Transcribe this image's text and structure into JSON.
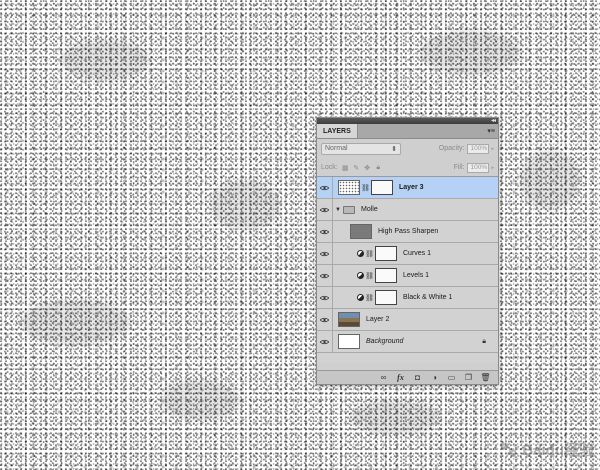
{
  "panel": {
    "tab_label": "LAYERS",
    "menu_icon": "panel-menu-icon",
    "blend_mode": "Normal",
    "opacity_label": "Opacity:",
    "opacity_value": "100%",
    "lock_label": "Lock:",
    "fill_label": "Fill:",
    "fill_value": "100%"
  },
  "layers": [
    {
      "name": "Layer 3",
      "selected": true,
      "type": "pixel-with-mask"
    },
    {
      "name": "Molle",
      "type": "group"
    },
    {
      "name": "High Pass Sharpen",
      "type": "pixel"
    },
    {
      "name": "Curves 1",
      "type": "adjustment"
    },
    {
      "name": "Levels 1",
      "type": "adjustment"
    },
    {
      "name": "Black & White 1",
      "type": "adjustment"
    },
    {
      "name": "Layer 2",
      "type": "pixel"
    },
    {
      "name": "Background",
      "type": "background",
      "locked": true
    }
  ],
  "footer_icons": [
    "link-layers-icon",
    "fx-icon",
    "add-mask-icon",
    "adjustment-layer-icon",
    "new-group-icon",
    "new-layer-icon",
    "delete-layer-icon"
  ],
  "watermark": {
    "text": "Baidu经验"
  }
}
